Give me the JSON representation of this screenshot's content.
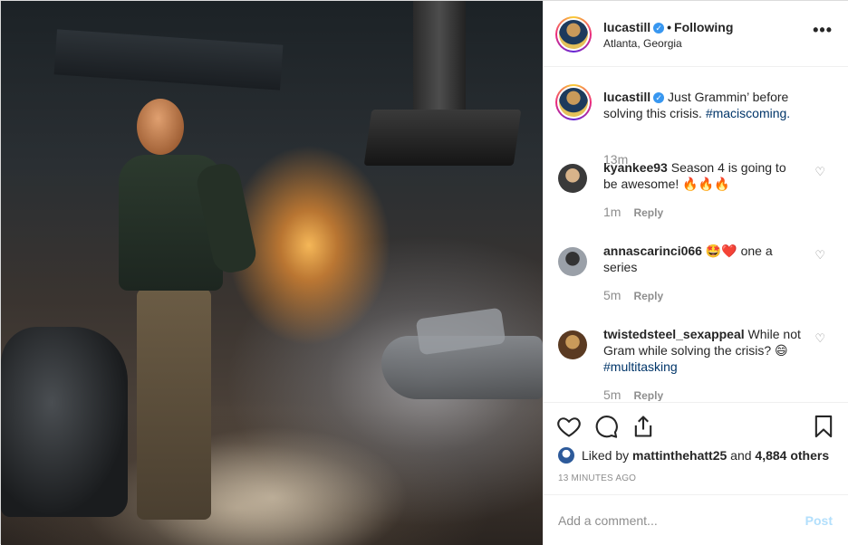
{
  "post": {
    "username": "lucastill",
    "following_label": "Following",
    "location": "Atlanta, Georgia",
    "more_label": "•••"
  },
  "caption": {
    "username": "lucastill",
    "text": "Just Grammin’ before solving this crisis.",
    "hashtag": "#maciscoming.",
    "time": "13m"
  },
  "comments": [
    {
      "username": "kyankee93",
      "text": "Season 4 is going to be awesome! 🔥🔥🔥",
      "hashtag": "",
      "time": "1m",
      "reply": "Reply"
    },
    {
      "username": "annascarinci066",
      "text": "🤩❤️ one a series",
      "hashtag": "",
      "time": "5m",
      "reply": "Reply"
    },
    {
      "username": "twistedsteel_sexappeal",
      "text": "While not Gram while solving the crisis? 😄",
      "hashtag": "#multitasking",
      "time": "5m",
      "reply": "Reply"
    }
  ],
  "likes": {
    "prefix": "Liked by",
    "user": "mattinthehatt25",
    "and": "and",
    "others": "4,884 others"
  },
  "time_ago": "13 MINUTES AGO",
  "add_comment": {
    "placeholder": "Add a comment...",
    "post_label": "Post"
  },
  "colors": {
    "link": "#003569",
    "muted": "#8e8e8e",
    "verified": "#3897f0",
    "post_disabled": "#b2dffc"
  },
  "icons": [
    "more-icon",
    "verified-icon",
    "heart-icon",
    "comment-icon",
    "share-icon",
    "bookmark-icon"
  ]
}
